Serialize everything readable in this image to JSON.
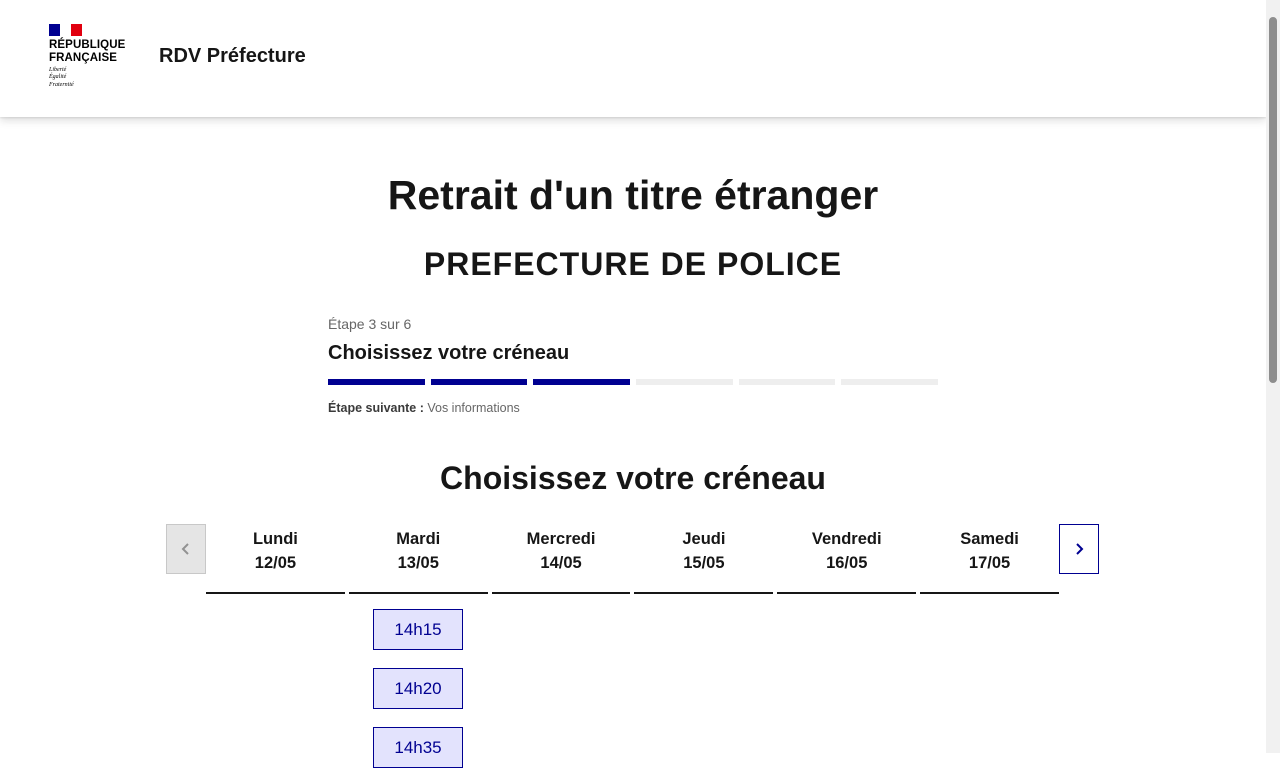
{
  "header": {
    "logo_lines": "RÉPUBLIQUE\nFRANÇAISE",
    "motto": "Liberté\nÉgalité\nFraternité",
    "site_title": "RDV Préfecture",
    "flag_colors": [
      "#000091",
      "#ffffff",
      "#e1000f"
    ]
  },
  "page": {
    "title": "Retrait d'un titre étranger",
    "subtitle": "PREFECTURE DE POLICE"
  },
  "stepper": {
    "state": "Étape 3 sur 6",
    "current_step": 3,
    "total_steps": 6,
    "title": "Choisissez votre créneau",
    "next_label": "Étape suivante :",
    "next_value": "Vos informations"
  },
  "calendar": {
    "section_title": "Choisissez votre créneau",
    "prev_icon": "chevron-left-icon",
    "next_icon": "chevron-right-icon",
    "days": [
      {
        "name": "Lundi",
        "date": "12/05"
      },
      {
        "name": "Mardi",
        "date": "13/05"
      },
      {
        "name": "Mercredi",
        "date": "14/05"
      },
      {
        "name": "Jeudi",
        "date": "15/05"
      },
      {
        "name": "Vendredi",
        "date": "16/05"
      },
      {
        "name": "Samedi",
        "date": "17/05"
      }
    ],
    "slots_day": "Mardi 13/05",
    "slots": [
      "14h15",
      "14h20",
      "14h35"
    ]
  },
  "colors": {
    "accent": "#000091",
    "slot_bg": "#e3e3fd",
    "step_inactive": "#eeeeee"
  }
}
